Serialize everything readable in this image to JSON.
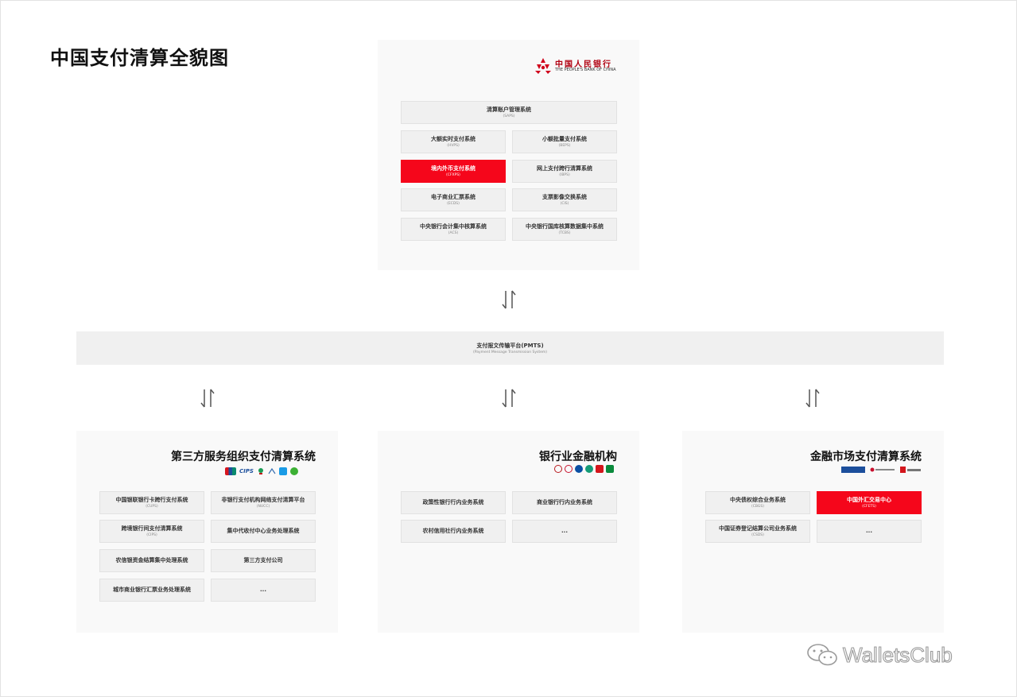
{
  "title": "中国支付清算全貌图",
  "pboc": {
    "logo_cn": "中国人民银行",
    "logo_en": "THE PEOPLE'S BANK OF CHINA",
    "top_system": {
      "name": "清算账户管理系统",
      "abbr": "(SAPS)"
    },
    "systems": [
      {
        "name": "大额实时支付系统",
        "abbr": "(HVPS)",
        "highlight": false
      },
      {
        "name": "小额批量支付系统",
        "abbr": "(BEPS)",
        "highlight": false
      },
      {
        "name": "境内外币支付系统",
        "abbr": "(CFXPS)",
        "highlight": true
      },
      {
        "name": "网上支付跨行清算系统",
        "abbr": "(IBPS)",
        "highlight": false
      },
      {
        "name": "电子商业汇票系统",
        "abbr": "(ECDS)",
        "highlight": false
      },
      {
        "name": "支票影像交换系统",
        "abbr": "(CIS)",
        "highlight": false
      },
      {
        "name": "中央银行会计集中核算系统",
        "abbr": "(ACS)",
        "highlight": false
      },
      {
        "name": "中央银行国库核算数据集中系统",
        "abbr": "(TCBS)",
        "highlight": false
      }
    ]
  },
  "pmts": {
    "name": "支付报文传输平台(PMTS)",
    "english": "(Payment Message Transmission System)"
  },
  "third_party": {
    "heading": "第三方服务组织支付清算系统",
    "logos": [
      "UnionPay",
      "CIPS",
      "nets",
      "alipay",
      "wechat"
    ],
    "systems": [
      {
        "name": "中国银联银行卡跨行支付系统",
        "abbr": "(CUPS)"
      },
      {
        "name": "非银行支付机构网络支付清算平台",
        "abbr": "(NUCC)"
      },
      {
        "name": "跨境银行间支付清算系统",
        "abbr": "(CIPS)"
      },
      {
        "name": "集中代收付中心业务处理系统",
        "abbr": ""
      },
      {
        "name": "农信银资金结算集中处理系统",
        "abbr": ""
      },
      {
        "name": "第三方支付公司",
        "abbr": ""
      },
      {
        "name": "城市商业银行汇票业务处理系统",
        "abbr": ""
      },
      {
        "name": "...",
        "abbr": ""
      }
    ]
  },
  "banking": {
    "heading": "银行业金融机构",
    "logos": [
      "boc",
      "icbc",
      "ccb",
      "abc",
      "cmb",
      "psbc"
    ],
    "systems": [
      {
        "name": "政策性银行行内业务系统",
        "abbr": ""
      },
      {
        "name": "商业银行行内业务系统",
        "abbr": ""
      },
      {
        "name": "农村信用社行内业务系统",
        "abbr": ""
      },
      {
        "name": "...",
        "abbr": ""
      }
    ]
  },
  "market": {
    "heading": "金融市场支付清算系统",
    "logos": [
      "shclearing",
      "cfets",
      "ccdc"
    ],
    "systems": [
      {
        "name": "中央债权综合业务系统",
        "abbr": "(CBGS)",
        "highlight": false
      },
      {
        "name": "中国外汇交易中心",
        "abbr": "(CFETS)",
        "highlight": true
      },
      {
        "name": "中国证券登记结算公司业务系统",
        "abbr": "(CSDS)",
        "highlight": false
      },
      {
        "name": "...",
        "abbr": "",
        "highlight": false
      }
    ]
  },
  "watermark": "WalletsClub",
  "colors": {
    "highlight": "#f5061b",
    "pboc_red": "#b00010",
    "panel": "#f9f9f9",
    "cell": "#f0f0f0"
  }
}
